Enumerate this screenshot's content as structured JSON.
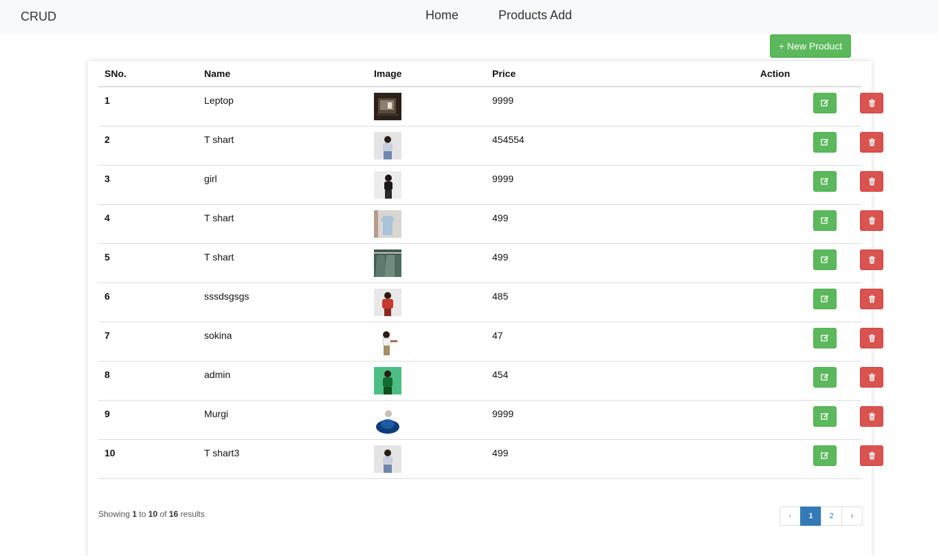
{
  "nav": {
    "brand": "CRUD",
    "links": [
      "Home",
      "Products Add"
    ]
  },
  "new_product_label": "+ New Product",
  "table": {
    "headers": [
      "SNo.",
      "Name",
      "Image",
      "Price",
      "Action"
    ],
    "rows": [
      {
        "sno": "1",
        "name": "Leptop",
        "price": "9999",
        "image": "laptop-photo"
      },
      {
        "sno": "2",
        "name": "T shart",
        "price": "454554",
        "image": "woman-tshirt-photo"
      },
      {
        "sno": "3",
        "name": "girl",
        "price": "9999",
        "image": "woman-black-outfit-photo"
      },
      {
        "sno": "4",
        "name": "T shart",
        "price": "499",
        "image": "hanging-shirt-photo"
      },
      {
        "sno": "5",
        "name": "T shart",
        "price": "499",
        "image": "green-shirts-rack-photo"
      },
      {
        "sno": "6",
        "name": "sssdsgsgs",
        "price": "485",
        "image": "woman-red-outfit-photo"
      },
      {
        "sno": "7",
        "name": "sokina",
        "price": "47",
        "image": "woman-pointing-photo"
      },
      {
        "sno": "8",
        "name": "admin",
        "price": "454",
        "image": "woman-green-background-photo"
      },
      {
        "sno": "9",
        "name": "Murgi",
        "price": "9999",
        "image": "woman-blue-fur-photo"
      },
      {
        "sno": "10",
        "name": "T shart3",
        "price": "499",
        "image": "woman-tshirt-photo"
      }
    ]
  },
  "footer": {
    "showing": "Showing",
    "from": "1",
    "to_word": "to",
    "to": "10",
    "of_word": "of",
    "total": "16",
    "results_word": "results"
  },
  "pagination": {
    "prev": "‹",
    "pages": [
      "1",
      "2"
    ],
    "next": "›",
    "current": "1"
  },
  "colors": {
    "edit": "#5cb85c",
    "delete": "#d9534f",
    "page_active": "#337ab7"
  }
}
